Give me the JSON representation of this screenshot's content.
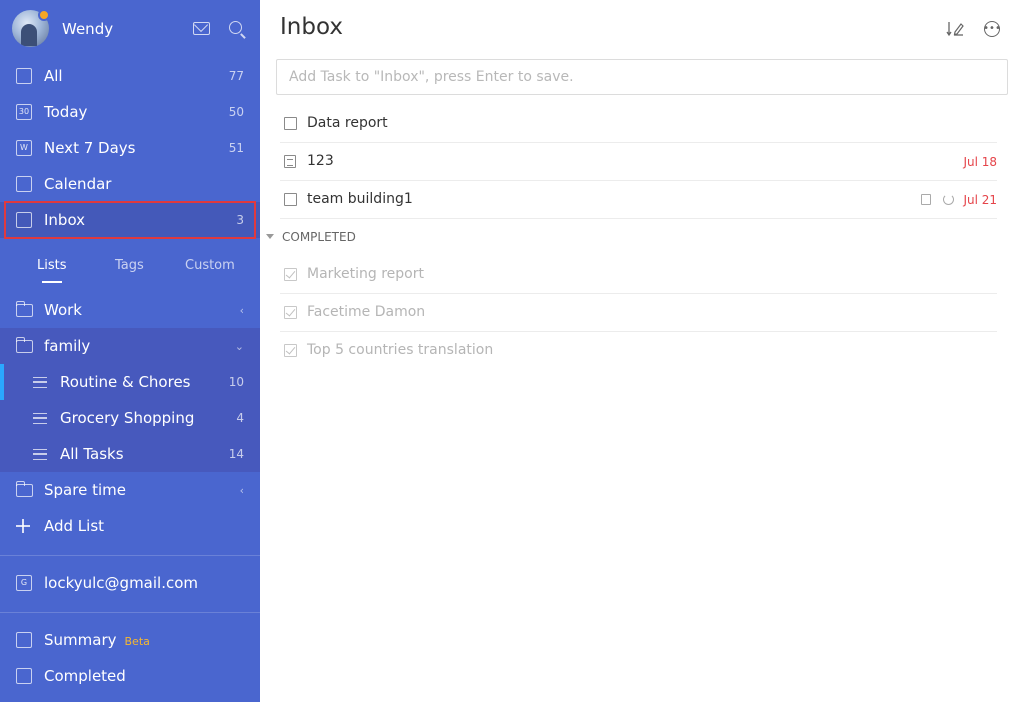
{
  "user": {
    "name": "Wendy"
  },
  "smart_lists": [
    {
      "label": "All",
      "count": "77",
      "icon": "all-icon"
    },
    {
      "label": "Today",
      "count": "50",
      "icon": "today-icon",
      "glyph": "30"
    },
    {
      "label": "Next 7 Days",
      "count": "51",
      "icon": "next-7-days-icon",
      "glyph": "W"
    },
    {
      "label": "Calendar",
      "count": "",
      "icon": "calendar-icon"
    },
    {
      "label": "Inbox",
      "count": "3",
      "icon": "inbox-icon"
    }
  ],
  "tabs": [
    {
      "label": "Lists",
      "active": true
    },
    {
      "label": "Tags",
      "active": false
    },
    {
      "label": "Custom",
      "active": false
    }
  ],
  "lists": {
    "work": {
      "label": "Work",
      "chevron": "‹"
    },
    "family": {
      "label": "family",
      "chevron": "⌄"
    },
    "family_children": [
      {
        "label": "Routine & Chores",
        "count": "10"
      },
      {
        "label": "Grocery Shopping",
        "count": "4"
      },
      {
        "label": "All Tasks",
        "count": "14"
      }
    ],
    "spare_time": {
      "label": "Spare time",
      "chevron": "‹"
    },
    "add_list": "Add List"
  },
  "account": {
    "label": "lockyulc@gmail.com",
    "glyph": "G"
  },
  "footer": {
    "summary": "Summary",
    "summary_badge": "Beta",
    "completed": "Completed"
  },
  "main": {
    "title": "Inbox",
    "add_task_placeholder": "Add Task to \"Inbox\", press Enter to save.",
    "tasks": [
      {
        "title": "Data report",
        "date": ""
      },
      {
        "title": "123",
        "date": "Jul 18"
      },
      {
        "title": "team building1",
        "date": "Jul 21"
      }
    ],
    "completed_header": "COMPLETED",
    "completed_tasks": [
      {
        "title": "Marketing report"
      },
      {
        "title": "Facetime Damon"
      },
      {
        "title": "Top 5 countries translation"
      }
    ]
  },
  "colors": {
    "sidebar": "#4a66cf",
    "accent": "#2aa8ff",
    "due_date": "#e5444a",
    "highlight_border": "#e0393e",
    "beta": "#f5b731"
  }
}
